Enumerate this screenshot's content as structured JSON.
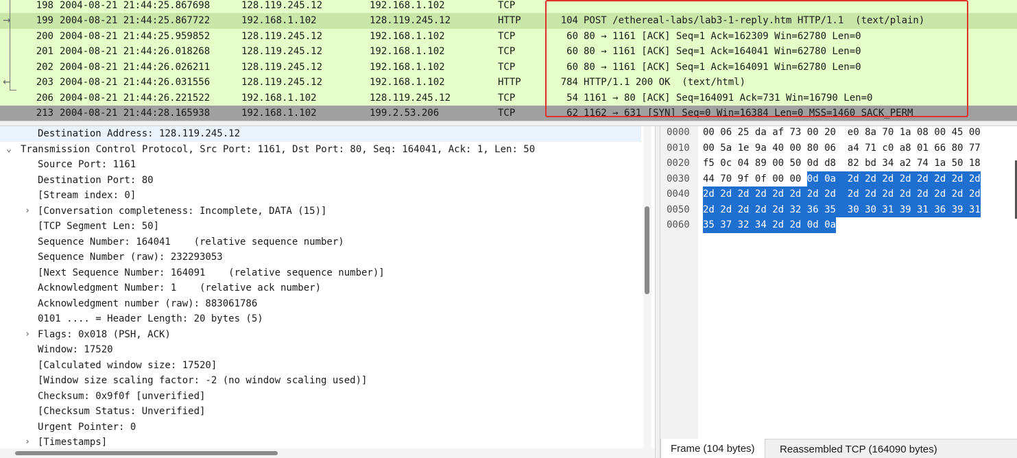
{
  "packet_list": {
    "rows": [
      {
        "no": "198",
        "time": "2004-08-21 21:44:25.867698",
        "src": "128.119.245.12",
        "dst": "192.168.1.102",
        "proto": "TCP",
        "len": "",
        "info": "",
        "style": "green"
      },
      {
        "no": "199",
        "time": "2004-08-21 21:44:25.867722",
        "src": "192.168.1.102",
        "dst": "128.119.245.12",
        "proto": "HTTP",
        "len": "104",
        "info": "POST /ethereal-labs/lab3-1-reply.htm HTTP/1.1  (text/plain)",
        "style": "green sel"
      },
      {
        "no": "200",
        "time": "2004-08-21 21:44:25.959852",
        "src": "128.119.245.12",
        "dst": "192.168.1.102",
        "proto": "TCP",
        "len": "60",
        "info": "80 → 1161 [ACK] Seq=1 Ack=162309 Win=62780 Len=0",
        "style": "green"
      },
      {
        "no": "201",
        "time": "2004-08-21 21:44:26.018268",
        "src": "128.119.245.12",
        "dst": "192.168.1.102",
        "proto": "TCP",
        "len": "60",
        "info": "80 → 1161 [ACK] Seq=1 Ack=164041 Win=62780 Len=0",
        "style": "green"
      },
      {
        "no": "202",
        "time": "2004-08-21 21:44:26.026211",
        "src": "128.119.245.12",
        "dst": "192.168.1.102",
        "proto": "TCP",
        "len": "60",
        "info": "80 → 1161 [ACK] Seq=1 Ack=164091 Win=62780 Len=0",
        "style": "green"
      },
      {
        "no": "203",
        "time": "2004-08-21 21:44:26.031556",
        "src": "128.119.245.12",
        "dst": "192.168.1.102",
        "proto": "HTTP",
        "len": "784",
        "info": "HTTP/1.1 200 OK  (text/html)",
        "style": "green"
      },
      {
        "no": "206",
        "time": "2004-08-21 21:44:26.221522",
        "src": "192.168.1.102",
        "dst": "128.119.245.12",
        "proto": "TCP",
        "len": "54",
        "info": "1161 → 80 [ACK] Seq=164091 Ack=731 Win=16790 Len=0",
        "style": "green"
      },
      {
        "no": "213",
        "time": "2004-08-21 21:44:28.165938",
        "src": "192.168.1.102",
        "dst": "199.2.53.206",
        "proto": "TCP",
        "len": "62",
        "info": "1162 → 631 [SYN] Seq=0 Win=16384 Len=0 MSS=1460 SACK_PERM",
        "style": "dark"
      }
    ]
  },
  "details": {
    "rows": [
      {
        "indent": 2,
        "arrow": "",
        "text": "Destination Address: 128.119.245.12",
        "hl": true
      },
      {
        "indent": 0,
        "arrow": "⌄",
        "text": "Transmission Control Protocol, Src Port: 1161, Dst Port: 80, Seq: 164041, Ack: 1, Len: 50",
        "hl": false
      },
      {
        "indent": 2,
        "arrow": "",
        "text": "Source Port: 1161",
        "hl": false
      },
      {
        "indent": 2,
        "arrow": "",
        "text": "Destination Port: 80",
        "hl": false
      },
      {
        "indent": 2,
        "arrow": "",
        "text": "[Stream index: 0]",
        "hl": false
      },
      {
        "indent": 1,
        "arrow": "›",
        "text": "[Conversation completeness: Incomplete, DATA (15)]",
        "hl": false
      },
      {
        "indent": 2,
        "arrow": "",
        "text": "[TCP Segment Len: 50]",
        "hl": false
      },
      {
        "indent": 2,
        "arrow": "",
        "text": "Sequence Number: 164041    (relative sequence number)",
        "hl": false
      },
      {
        "indent": 2,
        "arrow": "",
        "text": "Sequence Number (raw): 232293053",
        "hl": false
      },
      {
        "indent": 2,
        "arrow": "",
        "text": "[Next Sequence Number: 164091    (relative sequence number)]",
        "hl": false
      },
      {
        "indent": 2,
        "arrow": "",
        "text": "Acknowledgment Number: 1    (relative ack number)",
        "hl": false
      },
      {
        "indent": 2,
        "arrow": "",
        "text": "Acknowledgment number (raw): 883061786",
        "hl": false
      },
      {
        "indent": 2,
        "arrow": "",
        "text": "0101 .... = Header Length: 20 bytes (5)",
        "hl": false
      },
      {
        "indent": 1,
        "arrow": "›",
        "text": "Flags: 0x018 (PSH, ACK)",
        "hl": false
      },
      {
        "indent": 2,
        "arrow": "",
        "text": "Window: 17520",
        "hl": false
      },
      {
        "indent": 2,
        "arrow": "",
        "text": "[Calculated window size: 17520]",
        "hl": false
      },
      {
        "indent": 2,
        "arrow": "",
        "text": "[Window size scaling factor: -2 (no window scaling used)]",
        "hl": false
      },
      {
        "indent": 2,
        "arrow": "",
        "text": "Checksum: 0x9f0f [unverified]",
        "hl": false
      },
      {
        "indent": 2,
        "arrow": "",
        "text": "[Checksum Status: Unverified]",
        "hl": false
      },
      {
        "indent": 2,
        "arrow": "",
        "text": "Urgent Pointer: 0",
        "hl": false
      },
      {
        "indent": 1,
        "arrow": "›",
        "text": "[Timestamps]",
        "hl": false
      }
    ]
  },
  "bytes": {
    "rows": [
      {
        "offset": "0000",
        "hex": [
          "00",
          "06",
          "25",
          "da",
          "af",
          "73",
          "00",
          "20",
          "e0",
          "8a",
          "70",
          "1a",
          "08",
          "00",
          "45",
          "00"
        ],
        "sel_from": -1
      },
      {
        "offset": "0010",
        "hex": [
          "00",
          "5a",
          "1e",
          "9a",
          "40",
          "00",
          "80",
          "06",
          "a4",
          "71",
          "c0",
          "a8",
          "01",
          "66",
          "80",
          "77"
        ],
        "sel_from": -1
      },
      {
        "offset": "0020",
        "hex": [
          "f5",
          "0c",
          "04",
          "89",
          "00",
          "50",
          "0d",
          "d8",
          "82",
          "bd",
          "34",
          "a2",
          "74",
          "1a",
          "50",
          "18"
        ],
        "sel_from": -1
      },
      {
        "offset": "0030",
        "hex": [
          "44",
          "70",
          "9f",
          "0f",
          "00",
          "00",
          "0d",
          "0a",
          "2d",
          "2d",
          "2d",
          "2d",
          "2d",
          "2d",
          "2d",
          "2d"
        ],
        "sel_from": 6
      },
      {
        "offset": "0040",
        "hex": [
          "2d",
          "2d",
          "2d",
          "2d",
          "2d",
          "2d",
          "2d",
          "2d",
          "2d",
          "2d",
          "2d",
          "2d",
          "2d",
          "2d",
          "2d",
          "2d"
        ],
        "sel_from": 0
      },
      {
        "offset": "0050",
        "hex": [
          "2d",
          "2d",
          "2d",
          "2d",
          "2d",
          "32",
          "36",
          "35",
          "30",
          "30",
          "31",
          "39",
          "31",
          "36",
          "39",
          "31"
        ],
        "sel_from": 0
      },
      {
        "offset": "0060",
        "hex": [
          "35",
          "37",
          "32",
          "34",
          "2d",
          "2d",
          "0d",
          "0a"
        ],
        "sel_from": 0
      }
    ],
    "tabs": [
      "Frame (104 bytes)",
      "Reassembled TCP (164090 bytes)"
    ],
    "active_tab": 0
  },
  "colors": {
    "row_green": "#e4ffc7",
    "row_selected": "#c8e6a8",
    "row_dark": "#a0a0a0",
    "byte_highlight": "#1e6fd0",
    "annotation_box": "#e0302a"
  }
}
